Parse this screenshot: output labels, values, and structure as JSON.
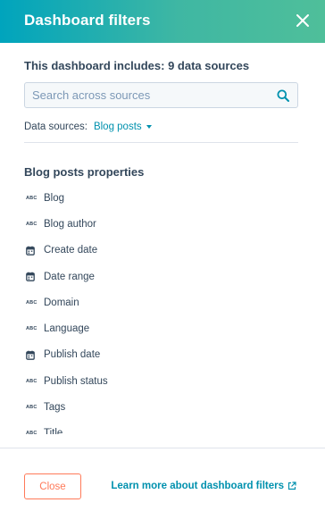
{
  "header": {
    "title": "Dashboard filters"
  },
  "summary": "This dashboard includes: 9 data sources",
  "search": {
    "placeholder": "Search across sources",
    "value": ""
  },
  "data_sources": {
    "label": "Data sources:",
    "selected": "Blog posts"
  },
  "section": {
    "title": "Blog posts properties"
  },
  "properties": [
    {
      "label": "Blog",
      "icon": "abc-text-icon"
    },
    {
      "label": "Blog author",
      "icon": "abc-text-icon"
    },
    {
      "label": "Create date",
      "icon": "calendar-icon"
    },
    {
      "label": "Date range",
      "icon": "calendar-icon"
    },
    {
      "label": "Domain",
      "icon": "abc-text-icon"
    },
    {
      "label": "Language",
      "icon": "abc-text-icon"
    },
    {
      "label": "Publish date",
      "icon": "calendar-icon"
    },
    {
      "label": "Publish status",
      "icon": "abc-text-icon"
    },
    {
      "label": "Tags",
      "icon": "abc-text-icon"
    },
    {
      "label": "Title",
      "icon": "abc-text-icon"
    }
  ],
  "footer": {
    "close_label": "Close",
    "learn_more_label": "Learn more about dashboard filters"
  },
  "colors": {
    "header_start": "#00a4bd",
    "header_end": "#4fbf9a",
    "link": "#0091ae",
    "close_button": "#ff7a59"
  }
}
